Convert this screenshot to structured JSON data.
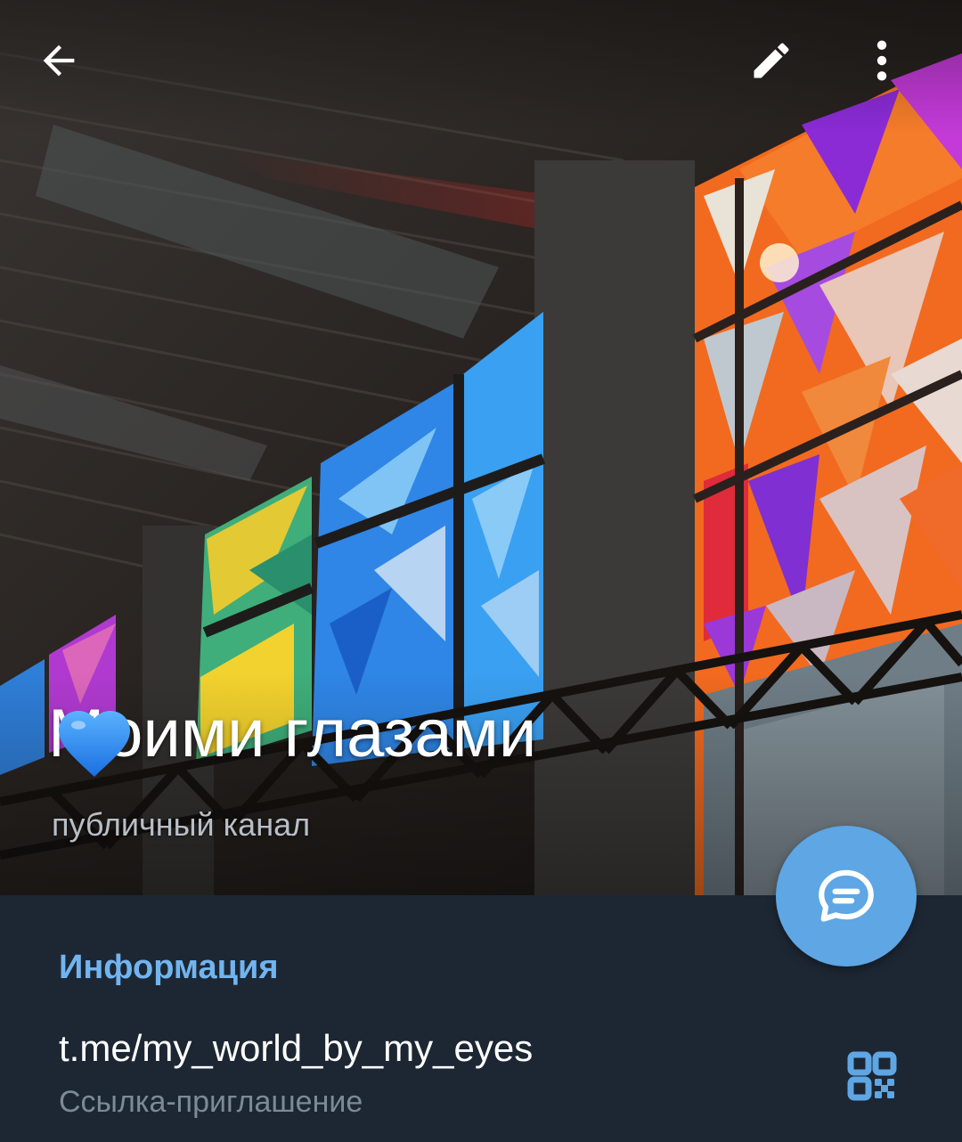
{
  "header": {
    "back_icon": "arrow-left-icon",
    "edit_icon": "pencil-icon",
    "more_icon": "more-vertical-icon"
  },
  "channel": {
    "title": "Моими глазами",
    "emoji": "blue-heart",
    "subtitle": "публичный канал"
  },
  "fab": {
    "icon": "message-bubble-icon"
  },
  "info": {
    "section_title": "Информация",
    "link": "t.me/my_world_by_my_eyes",
    "link_caption": "Ссылка-приглашение",
    "qr_icon": "qr-code-icon"
  },
  "colors": {
    "background": "#1d2733",
    "accent": "#71b4ef",
    "fab": "#5ea6e4",
    "caption": "#7d8a97"
  }
}
